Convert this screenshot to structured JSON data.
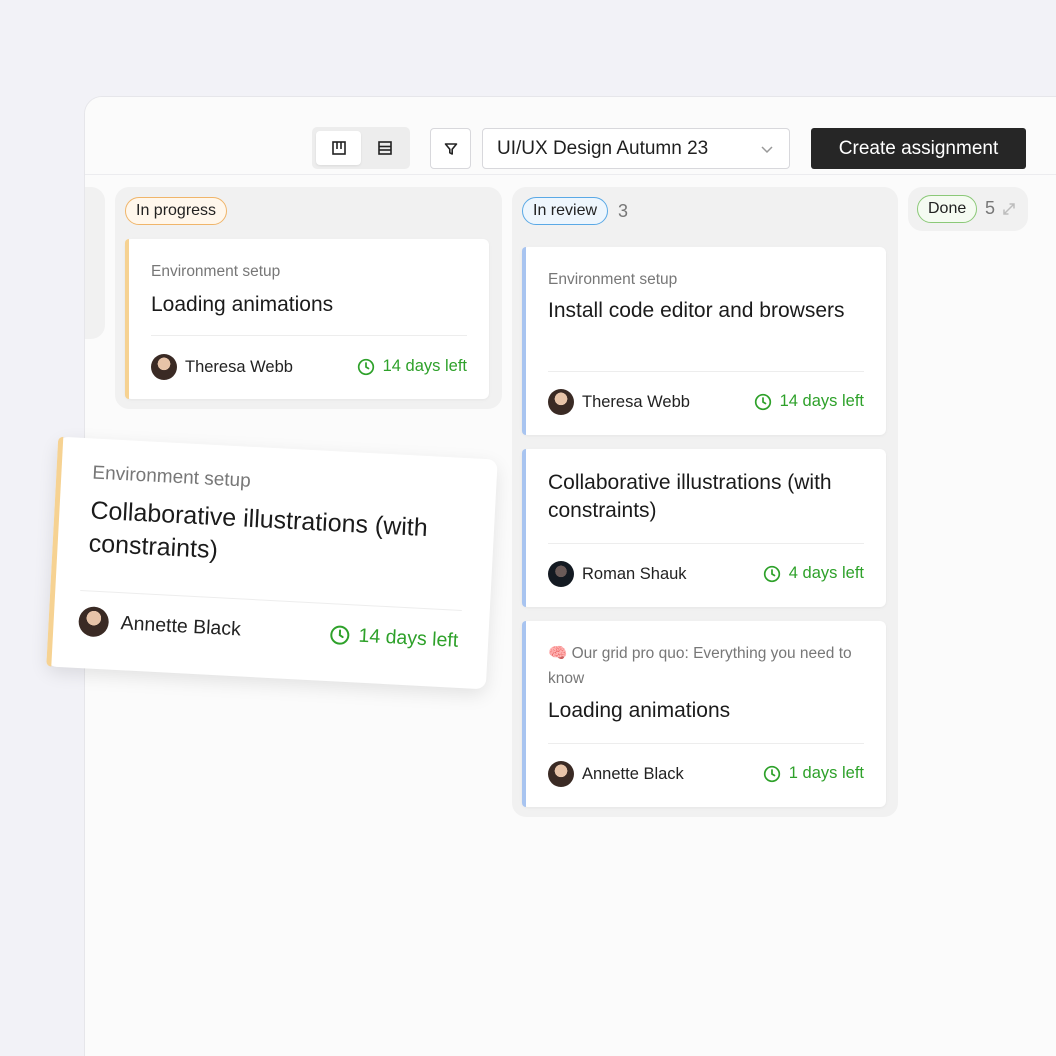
{
  "toolbar": {
    "course": "UI/UX Design Autumn 23",
    "create_label": "Create assignment"
  },
  "columns": {
    "in_progress": {
      "label": "In progress",
      "cards": [
        {
          "category": "Environment setup",
          "title": "Loading animations",
          "assignee": "Theresa Webb",
          "due": "14 days left"
        }
      ]
    },
    "in_review": {
      "label": "In review",
      "count": "3",
      "cards": [
        {
          "category": "Environment setup",
          "title": "Install code editor and browsers",
          "assignee": "Theresa Webb",
          "due": "14 days left"
        },
        {
          "title": "Collaborative illustrations (with constraints)",
          "assignee": "Roman Shauk",
          "due": "4 days left"
        },
        {
          "category": "🧠 Our grid pro quo: Everything you need to know",
          "title": "Loading animations",
          "assignee": "Annette Black",
          "due": "1 days left"
        }
      ]
    },
    "done": {
      "label": "Done",
      "count": "5"
    }
  },
  "dragging_card": {
    "category": "Environment setup",
    "title": "Collaborative illustrations (with constraints)",
    "assignee": "Annette Black",
    "due": "14 days left"
  },
  "icons": [
    "board-view-icon",
    "list-view-icon",
    "filter-icon",
    "chevron-down-icon",
    "clock-icon",
    "expand-icon"
  ],
  "colors": {
    "due_green": "#2ea12a",
    "progress_orange": "#f0b56a",
    "review_blue": "#5aa9e6",
    "done_green": "#8bc978",
    "button_dark": "#262626"
  }
}
